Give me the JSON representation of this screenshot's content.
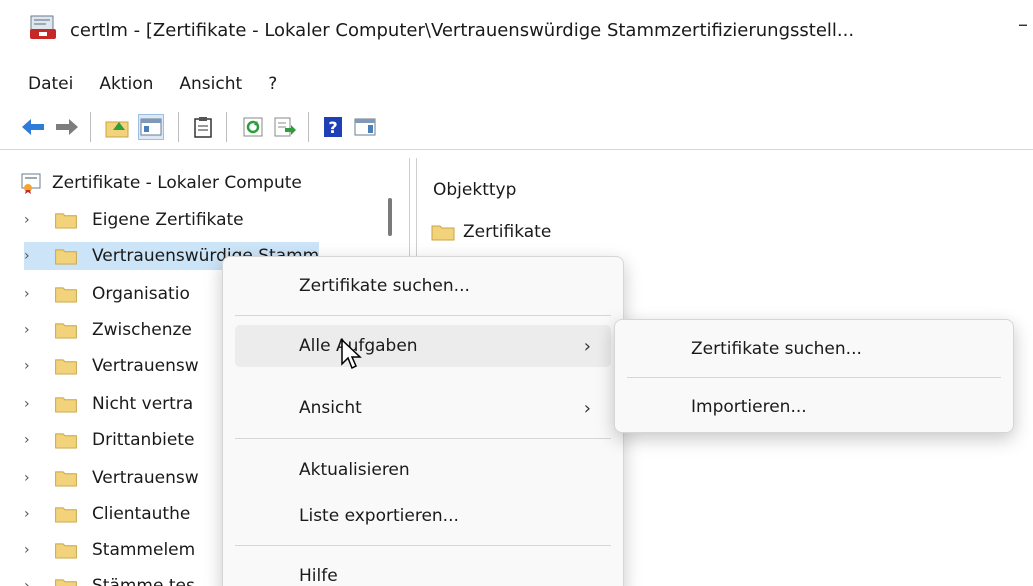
{
  "window": {
    "title": "certlm - [Zertifikate - Lokaler Computer\\Vertrauenswürdige Stammzertifizierungsstell...",
    "minimize_glyph": "–"
  },
  "menubar": [
    "Datei",
    "Aktion",
    "Ansicht",
    "?"
  ],
  "toolbar": {
    "icons": [
      "back-arrow-icon",
      "forward-arrow-icon",
      "up-folder-icon",
      "show-hide-tree-icon",
      "clipboard-icon",
      "refresh-icon",
      "export-list-icon",
      "help-icon",
      "action-pane-icon"
    ]
  },
  "tree": {
    "root_label": "Zertifikate - Lokaler Compute",
    "items": [
      {
        "label": "Eigene Zertifikate"
      },
      {
        "label": "Vertrauenswürdige Stamm"
      },
      {
        "label": "Organisatio"
      },
      {
        "label": "Zwischenze"
      },
      {
        "label": "Vertrauensw"
      },
      {
        "label": "Nicht vertra"
      },
      {
        "label": "Drittanbiete"
      },
      {
        "label": "Vertrauensw"
      },
      {
        "label": "Clientauthe"
      },
      {
        "label": "Stammelem"
      },
      {
        "label": "Stämme tes"
      }
    ],
    "chevron": "›"
  },
  "right_pane": {
    "column_header": "Objekttyp",
    "rows": [
      "Zertifikate"
    ]
  },
  "context_menu": {
    "items": [
      {
        "label": "Zertifikate suchen..."
      },
      {
        "label": "Alle Aufgaben",
        "submenu": "›"
      },
      {
        "label": "Ansicht",
        "submenu": "›"
      },
      {
        "label": "Aktualisieren"
      },
      {
        "label": "Liste exportieren..."
      },
      {
        "label": "Hilfe"
      }
    ]
  },
  "submenu": {
    "items": [
      {
        "label": "Zertifikate suchen..."
      },
      {
        "label": "Importieren..."
      }
    ]
  },
  "colors": {
    "accent_blue": "#2f7bd9",
    "folder_yellow": "#f2d27a",
    "selection": "#cce4f7"
  }
}
